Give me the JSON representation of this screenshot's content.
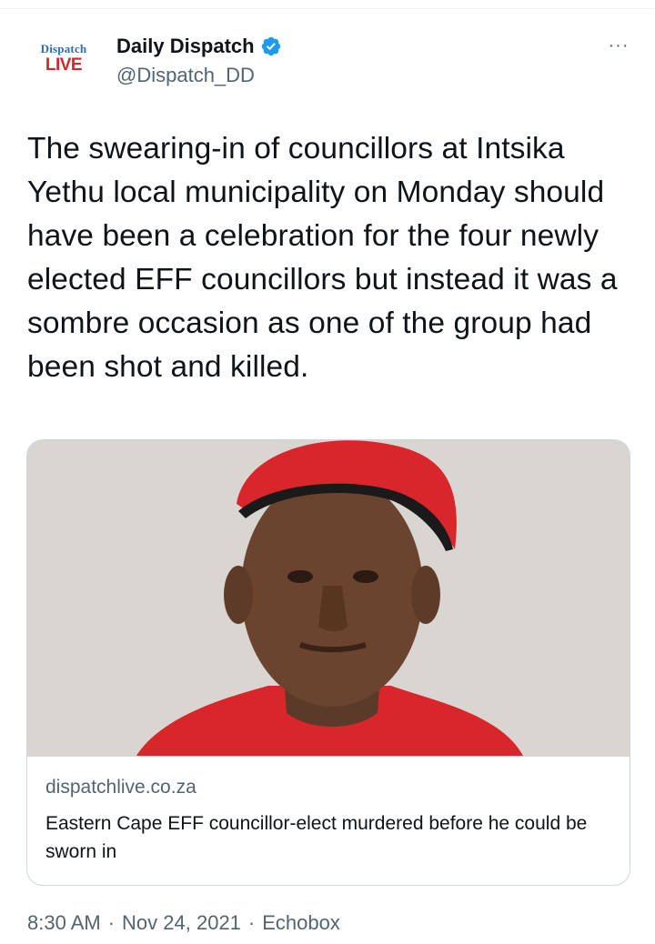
{
  "account": {
    "logo_top": "Dispatch",
    "logo_bottom": "LIVE",
    "display_name": "Daily Dispatch",
    "handle": "@Dispatch_DD",
    "verified_color": "#1d9bf0"
  },
  "more_button_label": "···",
  "tweet_text": "The swearing-in of councillors at Intsika Yethu local municipality on Monday should have been a celebration for the four newly elected EFF councillors but instead it was a sombre occasion as one of the group had been shot and killed.",
  "card": {
    "domain": "dispatchlive.co.za",
    "title": "Eastern Cape EFF councillor-elect murdered before he could be sworn in",
    "image_description_icon": "portrait-photo"
  },
  "meta": {
    "time": "8:30 AM",
    "date": "Nov 24, 2021",
    "source": "Echobox",
    "separator": "·"
  },
  "colors": {
    "text_primary": "#0f1419",
    "text_secondary": "#536471",
    "border": "#cfd9de",
    "beret_red": "#d9262b"
  }
}
